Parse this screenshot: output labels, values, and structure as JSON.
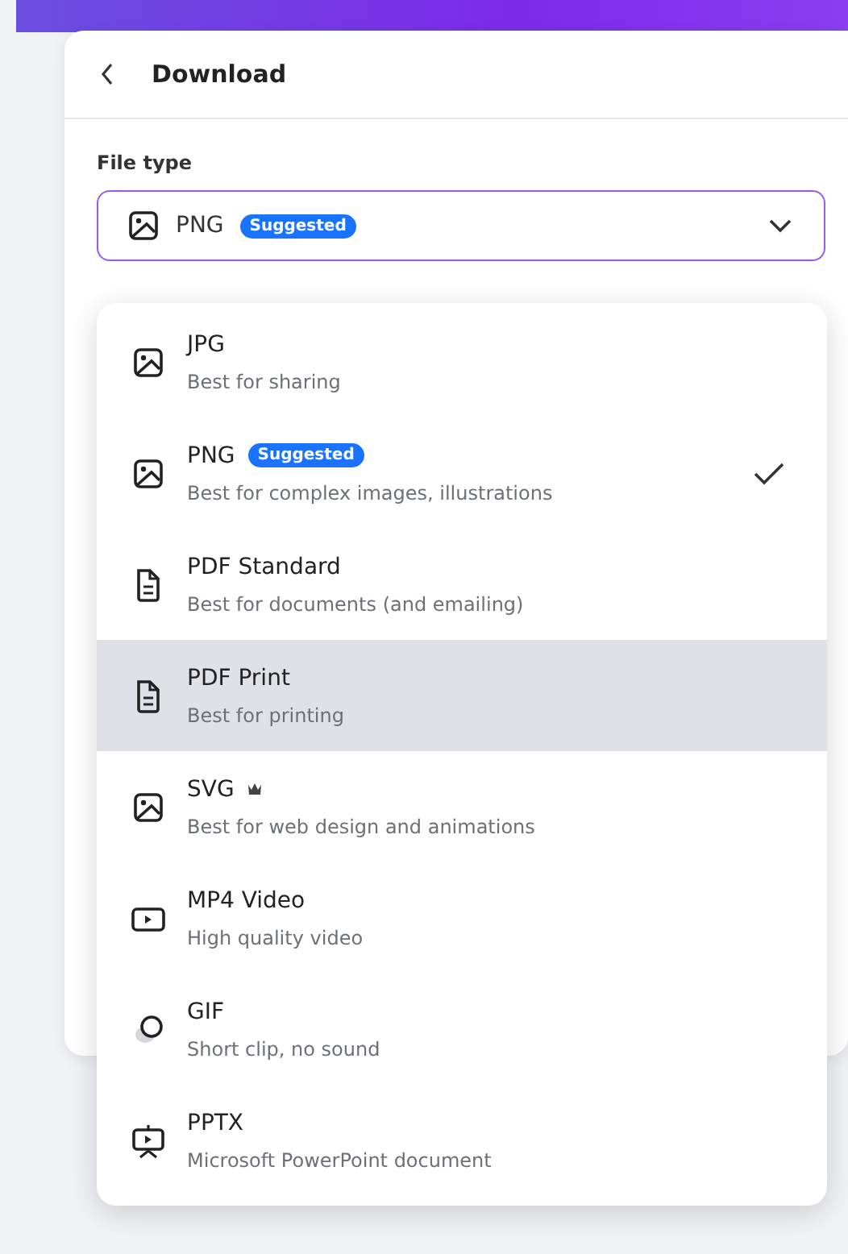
{
  "header": {
    "title": "Download"
  },
  "file_type": {
    "label": "File type",
    "value": "PNG",
    "kind": "image",
    "value_badge": "Suggested"
  },
  "options": [
    {
      "kind": "image",
      "name": "JPG",
      "description": "Best for sharing",
      "selected": false,
      "highlighted": false,
      "premium": false
    },
    {
      "kind": "image",
      "name": "PNG",
      "badge": "Suggested",
      "description": "Best for complex images, illustrations",
      "selected": true,
      "highlighted": false,
      "premium": false
    },
    {
      "kind": "document",
      "name": "PDF Standard",
      "description": "Best for documents (and emailing)",
      "selected": false,
      "highlighted": false,
      "premium": false
    },
    {
      "kind": "document",
      "name": "PDF Print",
      "description": "Best for printing",
      "selected": false,
      "highlighted": true,
      "premium": false
    },
    {
      "kind": "image",
      "name": "SVG",
      "description": "Best for web design and animations",
      "selected": false,
      "highlighted": false,
      "premium": true
    },
    {
      "kind": "video",
      "name": "MP4 Video",
      "description": "High quality video",
      "selected": false,
      "highlighted": false,
      "premium": false
    },
    {
      "kind": "gif",
      "name": "GIF",
      "description": "Short clip, no sound",
      "selected": false,
      "highlighted": false,
      "premium": false
    },
    {
      "kind": "presentation",
      "name": "PPTX",
      "description": "Microsoft PowerPoint document",
      "selected": false,
      "highlighted": false,
      "premium": false
    }
  ]
}
